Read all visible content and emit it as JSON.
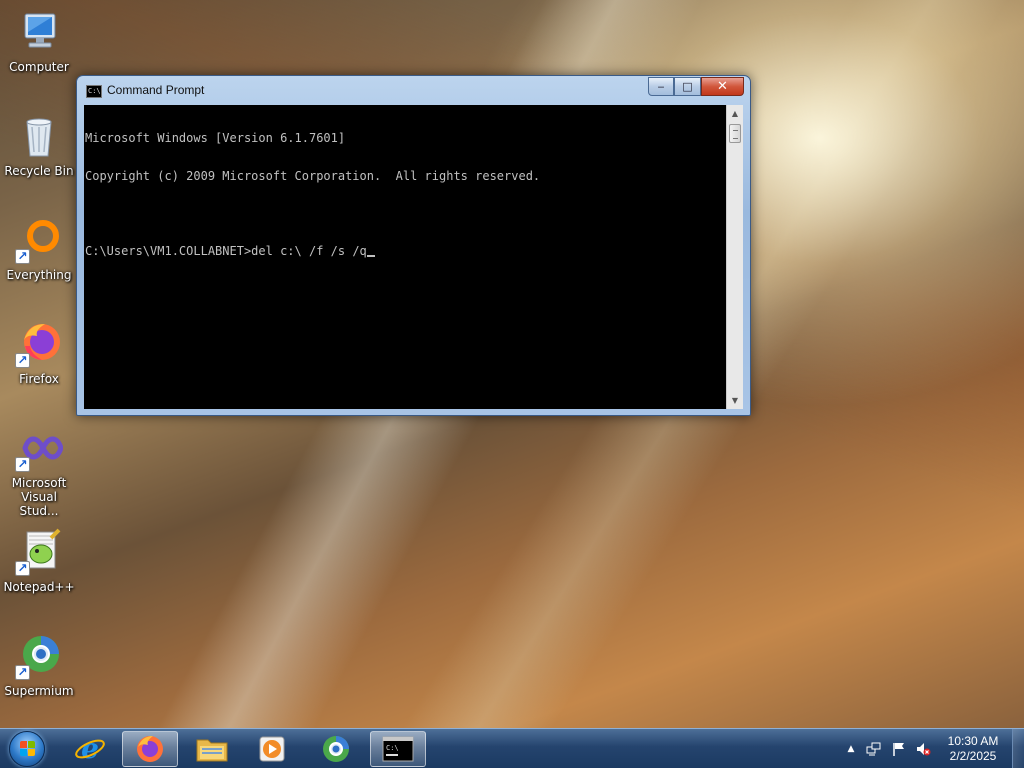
{
  "desktop": {
    "icons": [
      {
        "label": "Computer",
        "icon": "computer-icon"
      },
      {
        "label": "Recycle Bin",
        "icon": "recycle-bin-icon"
      },
      {
        "label": "Everything",
        "icon": "everything-icon"
      },
      {
        "label": "Firefox",
        "icon": "firefox-icon"
      },
      {
        "label": "Microsoft Visual Stud...",
        "icon": "visual-studio-icon"
      },
      {
        "label": "Notepad++",
        "icon": "notepadpp-icon"
      },
      {
        "label": "Supermium",
        "icon": "supermium-icon"
      }
    ]
  },
  "window": {
    "title": "Command Prompt",
    "icon_text": "C:\\",
    "buttons": {
      "minimize": "‒",
      "maximize": "□",
      "close": "✕"
    },
    "console": {
      "lines": [
        "Microsoft Windows [Version 6.1.7601]",
        "Copyright (c) 2009 Microsoft Corporation.  All rights reserved.",
        ""
      ],
      "prompt": "C:\\Users\\VM1.COLLABNET>",
      "command": "del c:\\ /f /s /q"
    }
  },
  "taskbar": {
    "items": [
      "start-orb",
      "internet-explorer-icon",
      "firefox-icon",
      "file-explorer-icon",
      "media-player-icon",
      "supermium-icon",
      "command-prompt-icon"
    ],
    "active_item": "firefox-icon",
    "tray": {
      "show_hidden": "▲",
      "time": "10:30 AM",
      "date": "2/2/2025"
    }
  },
  "colors": {
    "console_bg": "#000000",
    "console_fg": "#c0c0c0",
    "taskbar": "#25446e",
    "close_button": "#c94a2e"
  }
}
